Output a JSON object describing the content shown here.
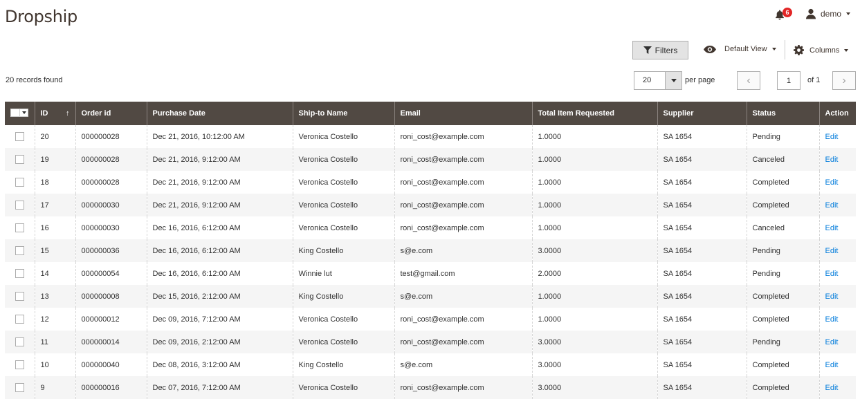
{
  "page": {
    "title": "Dropship"
  },
  "header": {
    "notifications_count": "6",
    "user_name": "demo"
  },
  "toolbar": {
    "filters_label": "Filters",
    "view_label": "Default View",
    "columns_label": "Columns"
  },
  "grid": {
    "records_found": "20 records found",
    "per_page_value": "20",
    "per_page_label": "per page",
    "current_page": "1",
    "total_pages_label": "of 1",
    "prev_symbol": "‹",
    "next_symbol": "›",
    "sort_indicator": "↑",
    "columns": [
      "ID",
      "Order id",
      "Purchase Date",
      "Ship-to Name",
      "Email",
      "Total Item Requested",
      "Supplier",
      "Status",
      "Action"
    ],
    "rows": [
      {
        "id": "20",
        "order_id": "000000028",
        "purchase_date": "Dec 21, 2016, 10:12:00 AM",
        "ship_to": "Veronica Costello",
        "email": "roni_cost@example.com",
        "total": "1.0000",
        "supplier": "SA 1654",
        "status": "Pending",
        "action": "Edit"
      },
      {
        "id": "19",
        "order_id": "000000028",
        "purchase_date": "Dec 21, 2016, 9:12:00 AM",
        "ship_to": "Veronica Costello",
        "email": "roni_cost@example.com",
        "total": "1.0000",
        "supplier": "SA 1654",
        "status": "Canceled",
        "action": "Edit"
      },
      {
        "id": "18",
        "order_id": "000000028",
        "purchase_date": "Dec 21, 2016, 9:12:00 AM",
        "ship_to": "Veronica Costello",
        "email": "roni_cost@example.com",
        "total": "1.0000",
        "supplier": "SA 1654",
        "status": "Completed",
        "action": "Edit"
      },
      {
        "id": "17",
        "order_id": "000000030",
        "purchase_date": "Dec 21, 2016, 9:12:00 AM",
        "ship_to": "Veronica Costello",
        "email": "roni_cost@example.com",
        "total": "1.0000",
        "supplier": "SA 1654",
        "status": "Completed",
        "action": "Edit"
      },
      {
        "id": "16",
        "order_id": "000000030",
        "purchase_date": "Dec 16, 2016, 6:12:00 AM",
        "ship_to": "Veronica Costello",
        "email": "roni_cost@example.com",
        "total": "1.0000",
        "supplier": "SA 1654",
        "status": "Canceled",
        "action": "Edit"
      },
      {
        "id": "15",
        "order_id": "000000036",
        "purchase_date": "Dec 16, 2016, 6:12:00 AM",
        "ship_to": "King Costello",
        "email": "s@e.com",
        "total": "3.0000",
        "supplier": "SA 1654",
        "status": "Pending",
        "action": "Edit"
      },
      {
        "id": "14",
        "order_id": "000000054",
        "purchase_date": "Dec 16, 2016, 6:12:00 AM",
        "ship_to": "Winnie lut",
        "email": "test@gmail.com",
        "total": "2.0000",
        "supplier": "SA 1654",
        "status": "Pending",
        "action": "Edit"
      },
      {
        "id": "13",
        "order_id": "000000008",
        "purchase_date": "Dec 15, 2016, 2:12:00 AM",
        "ship_to": "King Costello",
        "email": "s@e.com",
        "total": "1.0000",
        "supplier": "SA 1654",
        "status": "Completed",
        "action": "Edit"
      },
      {
        "id": "12",
        "order_id": "000000012",
        "purchase_date": "Dec 09, 2016, 7:12:00 AM",
        "ship_to": "Veronica Costello",
        "email": "roni_cost@example.com",
        "total": "1.0000",
        "supplier": "SA 1654",
        "status": "Completed",
        "action": "Edit"
      },
      {
        "id": "11",
        "order_id": "000000014",
        "purchase_date": "Dec 09, 2016, 2:12:00 AM",
        "ship_to": "Veronica Costello",
        "email": "roni_cost@example.com",
        "total": "3.0000",
        "supplier": "SA 1654",
        "status": "Pending",
        "action": "Edit"
      },
      {
        "id": "10",
        "order_id": "000000040",
        "purchase_date": "Dec 08, 2016, 3:12:00 AM",
        "ship_to": "King Costello",
        "email": "s@e.com",
        "total": "3.0000",
        "supplier": "SA 1654",
        "status": "Completed",
        "action": "Edit"
      },
      {
        "id": "9",
        "order_id": "000000016",
        "purchase_date": "Dec 07, 2016, 7:12:00 AM",
        "ship_to": "Veronica Costello",
        "email": "roni_cost@example.com",
        "total": "3.0000",
        "supplier": "SA 1654",
        "status": "Completed",
        "action": "Edit"
      }
    ]
  },
  "icons": {
    "notification": "bell-icon",
    "user": "user-icon",
    "filter": "funnel-icon",
    "view": "eye-icon",
    "columns": "gear-icon"
  },
  "colors": {
    "header_bg": "#514943",
    "link": "#007bdb",
    "badge": "#e22626",
    "text": "#41362f"
  }
}
